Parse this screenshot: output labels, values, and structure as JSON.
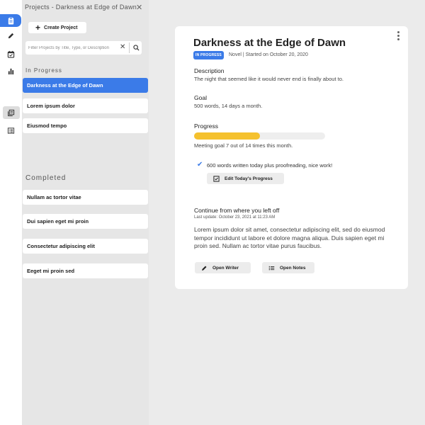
{
  "rail": {
    "icons": [
      "clipboard-icon",
      "pencil-icon",
      "calendar-check-icon",
      "bar-chart-icon",
      "library-icon",
      "list-icon"
    ]
  },
  "panel": {
    "title": "Projects - Darkness at Edge of Dawn",
    "create_label": "Create Project",
    "filter_placeholder": "Filter Projects by Title, Type, or Description",
    "in_progress_label": "In Progress",
    "in_progress": [
      "Darkness at the Edge of Dawn",
      "Lorem ipsum dolor",
      "Eiusmod tempo"
    ],
    "completed_label": "Completed",
    "completed": [
      "Nullam ac tortor vitae",
      "Dui sapien eget mi proin",
      "Consectetur adipiscing elit",
      "Eeget mi proin sed"
    ]
  },
  "card": {
    "title": "Darkness at the Edge of Dawn",
    "badge": "IN PROGRESS",
    "meta": "Novel | Started on October 20, 2020",
    "description_label": "Description",
    "description": "The night that seemed like it would never end is finally about to.",
    "goal_label": "Goal",
    "goal": "500 words, 14 days a month.",
    "progress_label": "Progress",
    "progress_fraction": 0.5,
    "progress_text": "Meeting goal 7 out of 14 times this month.",
    "today_text": "600 words written today plus proofreading, nice work!",
    "edit_label": "Edit Today's Progress",
    "continue_label": "Continue from where you left off",
    "last_update": "Last update: October 23, 2021 at 11:23 AM",
    "continue_text": "Lorem ipsum dolor sit amet, consectetur adipiscing elit, sed do eiusmod tempor incididunt ut labore et dolore magna aliqua. Duis sapien eget mi proin sed. Nullam ac tortor vitae purus faucibus.",
    "open_writer_label": "Open Writer",
    "open_notes_label": "Open Notes"
  },
  "colors": {
    "accent": "#3b7be8",
    "progress": "#f5c12e"
  }
}
